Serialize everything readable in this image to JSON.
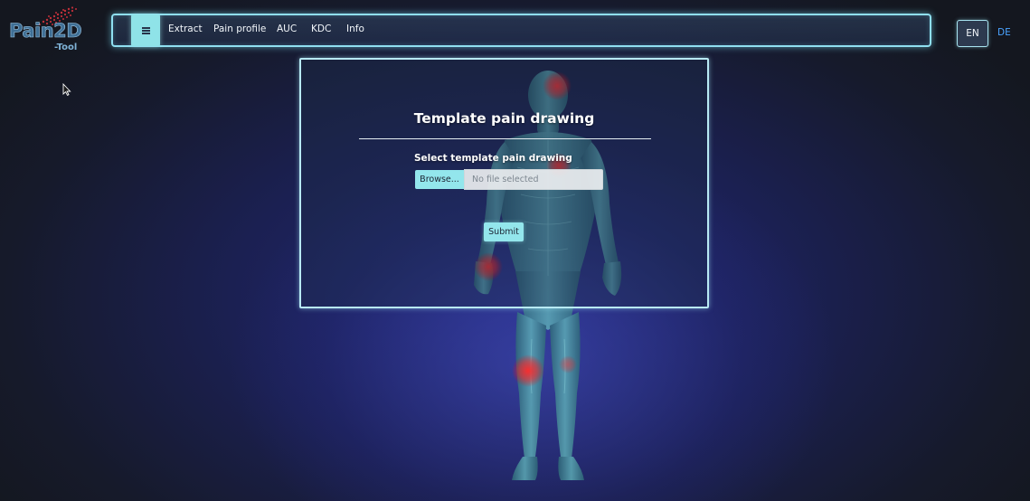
{
  "logo": {
    "name": "Pain2D",
    "suffix": "-Tool"
  },
  "navbar": {
    "menu_icon": "hamburger-icon",
    "items": [
      {
        "label": "Extract"
      },
      {
        "label": "Pain profile"
      },
      {
        "label": "AUC"
      },
      {
        "label": "KDC"
      },
      {
        "label": "Info"
      }
    ]
  },
  "language": {
    "active": "EN",
    "other": "DE"
  },
  "form": {
    "title": "Template pain drawing",
    "field_label": "Select template pain drawing",
    "browse_label": "Browse...",
    "file_status": "No file selected",
    "submit_label": "Submit"
  },
  "colors": {
    "accent": "#93e6ec",
    "nav_border": "#8fdff0",
    "link_blue": "#4aa3ff",
    "pain_red": "#ff2a2a"
  }
}
